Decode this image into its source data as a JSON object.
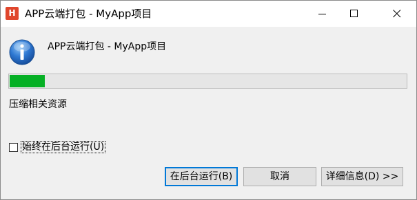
{
  "window": {
    "title": "APP云端打包 - MyApp项目",
    "logo_letter": "H",
    "logo_color": "#e0462c",
    "controls": [
      "minimize-icon",
      "maximize-icon",
      "close-icon"
    ]
  },
  "dialog": {
    "icon": "info-icon",
    "heading": "APP云端打包 - MyApp项目",
    "progress": {
      "percent": 9,
      "color": "#06b025"
    },
    "status": "压缩相关资源",
    "checkbox": {
      "label": "始终在后台运行(U)",
      "checked": false
    }
  },
  "buttons": {
    "run_in_background": "在后台运行(B)",
    "cancel": "取消",
    "details": "详细信息(D) >>"
  }
}
